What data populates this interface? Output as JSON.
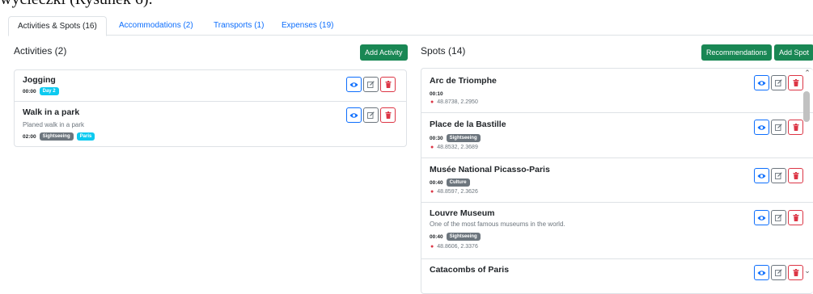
{
  "top_text": "wycieczki (Rysunek 6).",
  "tabs": [
    {
      "label": "Activities & Spots (16)"
    },
    {
      "label": "Accommodations (2)"
    },
    {
      "label": "Transports (1)"
    },
    {
      "label": "Expenses (19)"
    }
  ],
  "activities": {
    "title": "Activities (2)",
    "add_label": "Add Activity",
    "items": [
      {
        "name": "Jogging",
        "time": "00:00",
        "badges": [
          "Day 2"
        ]
      },
      {
        "name": "Walk in a park",
        "description": "Planed walk in a park",
        "time": "02:00",
        "badges": [
          "Sightseeing",
          "Paris"
        ]
      }
    ]
  },
  "spots": {
    "title": "Spots (14)",
    "recommend_label": "Recommendations",
    "add_label": "Add Spot",
    "items": [
      {
        "name": "Arc de Triomphe",
        "time": "00:10",
        "coords": "48.8738, 2.2950"
      },
      {
        "name": "Place de la Bastille",
        "time": "00:30",
        "badge": "Sightseeing",
        "coords": "48.8532, 2.3689"
      },
      {
        "name": "Musée National Picasso-Paris",
        "time": "00:40",
        "badge": "Culture",
        "coords": "48.8597, 2.3626"
      },
      {
        "name": "Louvre Museum",
        "description": "One of the most famous museums in the world.",
        "time": "00:40",
        "badge": "Sightseeing",
        "coords": "48.8606, 2.3376"
      },
      {
        "name": "Catacombs of Paris"
      }
    ]
  },
  "icons": {
    "view": "eye-icon",
    "edit": "edit-icon",
    "delete": "trash-icon",
    "pin": "map-pin-icon"
  },
  "colors": {
    "primary": "#0d6efd",
    "success": "#198754",
    "danger": "#dc3545",
    "info": "#0dcaf0",
    "secondary": "#6c757d"
  }
}
